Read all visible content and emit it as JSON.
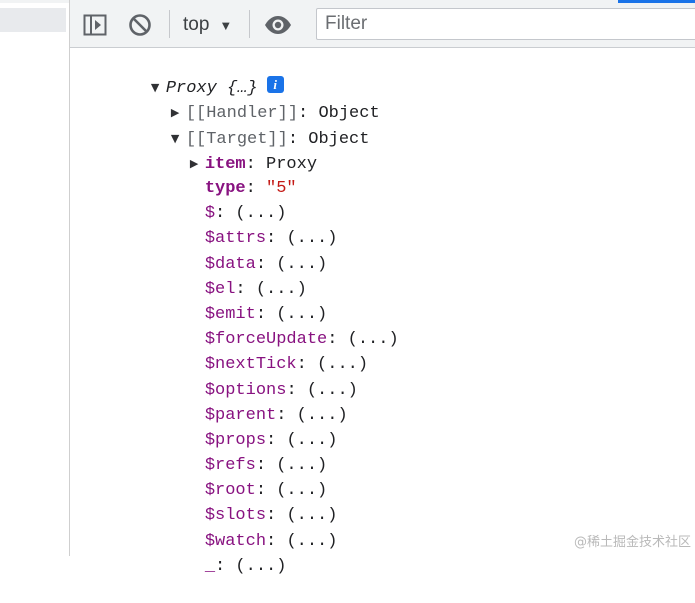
{
  "toolbar": {
    "sidebar_toggle_icon": "sidebar-toggle-icon",
    "clear_icon": "block-icon",
    "context": "top",
    "context_arrow": "▼",
    "eye_icon": "eye-icon",
    "filter_placeholder": "Filter"
  },
  "console": {
    "proxy_label": "Proxy",
    "proxy_preview": "{…}",
    "info_badge": "i",
    "handler": {
      "key": "[[Handler]]",
      "sep": ": ",
      "value": "Object"
    },
    "target": {
      "key": "[[Target]]",
      "sep": ": ",
      "value": "Object"
    },
    "properties": [
      {
        "key": "item",
        "sep": ": ",
        "value": "Proxy"
      },
      {
        "key": "type",
        "sep": ": ",
        "value": "\"5\""
      },
      {
        "key": "$",
        "sep": ": ",
        "value": "(...)"
      },
      {
        "key": "$attrs",
        "sep": ": ",
        "value": "(...)"
      },
      {
        "key": "$data",
        "sep": ": ",
        "value": "(...)"
      },
      {
        "key": "$el",
        "sep": ": ",
        "value": "(...)"
      },
      {
        "key": "$emit",
        "sep": ": ",
        "value": "(...)"
      },
      {
        "key": "$forceUpdate",
        "sep": ": ",
        "value": "(...)"
      },
      {
        "key": "$nextTick",
        "sep": ": ",
        "value": "(...)"
      },
      {
        "key": "$options",
        "sep": ": ",
        "value": "(...)"
      },
      {
        "key": "$parent",
        "sep": ": ",
        "value": "(...)"
      },
      {
        "key": "$props",
        "sep": ": ",
        "value": "(...)"
      },
      {
        "key": "$refs",
        "sep": ": ",
        "value": "(...)"
      },
      {
        "key": "$root",
        "sep": ": ",
        "value": "(...)"
      },
      {
        "key": "$slots",
        "sep": ": ",
        "value": "(...)"
      },
      {
        "key": "$watch",
        "sep": ": ",
        "value": "(...)"
      },
      {
        "key": "_",
        "sep": ": ",
        "value": "(...)"
      }
    ]
  },
  "watermark": "@稀土掘金技术社区",
  "colors": {
    "toolbar_bg": "#f1f3f4",
    "key_purple": "#881280",
    "string_red": "#c41a16",
    "accent_blue": "#1a73e8"
  }
}
